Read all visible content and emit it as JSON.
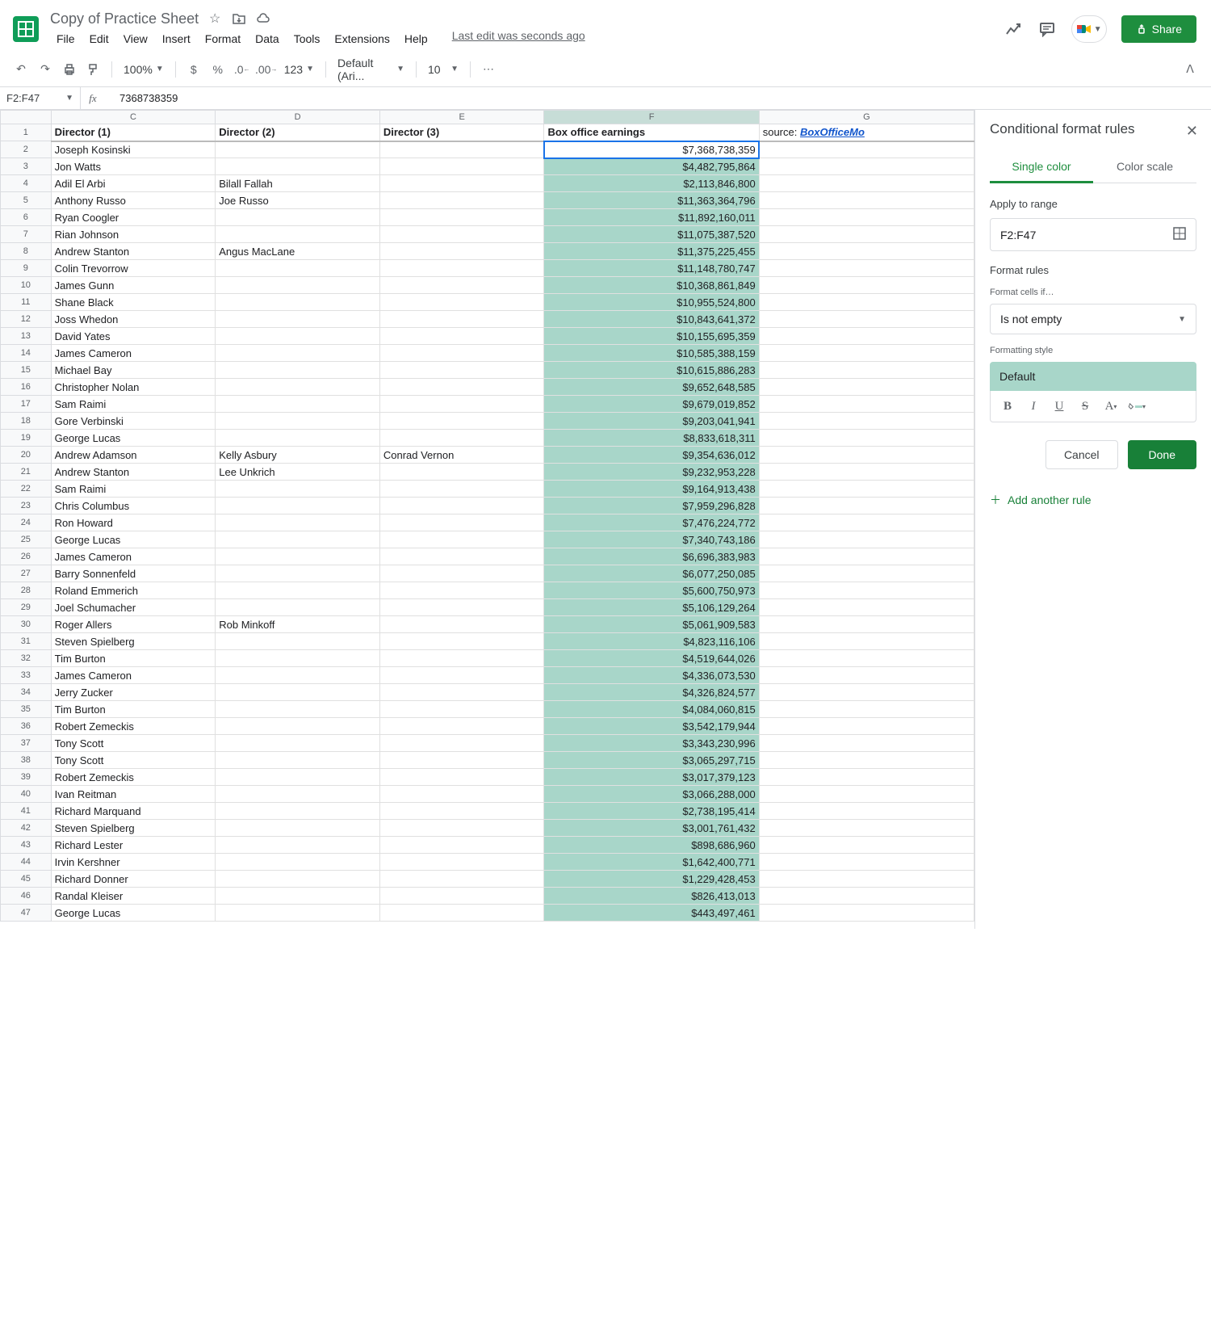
{
  "doc": {
    "title": "Copy of Practice Sheet"
  },
  "menubar": {
    "file": "File",
    "edit": "Edit",
    "view": "View",
    "insert": "Insert",
    "format": "Format",
    "data": "Data",
    "tools": "Tools",
    "extensions": "Extensions",
    "help": "Help",
    "edit_info": "Last edit was seconds ago"
  },
  "share": {
    "label": "Share"
  },
  "toolbar": {
    "zoom": "100%",
    "font": "Default (Ari...",
    "fontsize": "10"
  },
  "namebox": {
    "ref": "F2:F47",
    "fxval": "7368738359"
  },
  "sidepanel": {
    "title": "Conditional format rules",
    "tab_single": "Single color",
    "tab_scale": "Color scale",
    "apply_label": "Apply to range",
    "range_value": "F2:F47",
    "rules_label": "Format rules",
    "cells_if": "Format cells if…",
    "condition": "Is not empty",
    "style_label": "Formatting style",
    "style_name": "Default",
    "cancel": "Cancel",
    "done": "Done",
    "add_rule": "Add another rule"
  },
  "headers": {
    "C": "Director (1)",
    "D": "Director (2)",
    "E": "Director (3)",
    "F": "Box office earnings",
    "G_prefix": "source: ",
    "G_link": "BoxOfficeMo"
  },
  "cols": {
    "C": "C",
    "D": "D",
    "E": "E",
    "F": "F",
    "G": "G"
  },
  "rows": [
    {
      "n": 2,
      "c": "Joseph Kosinski",
      "d": "",
      "e": "",
      "f": "$7,368,738,359"
    },
    {
      "n": 3,
      "c": "Jon Watts",
      "d": "",
      "e": "",
      "f": "$4,482,795,864"
    },
    {
      "n": 4,
      "c": "Adil El Arbi",
      "d": "Bilall Fallah",
      "e": "",
      "f": "$2,113,846,800"
    },
    {
      "n": 5,
      "c": "Anthony Russo",
      "d": "Joe Russo",
      "e": "",
      "f": "$11,363,364,796"
    },
    {
      "n": 6,
      "c": "Ryan Coogler",
      "d": "",
      "e": "",
      "f": "$11,892,160,011"
    },
    {
      "n": 7,
      "c": "Rian Johnson",
      "d": "",
      "e": "",
      "f": "$11,075,387,520"
    },
    {
      "n": 8,
      "c": "Andrew Stanton",
      "d": "Angus MacLane",
      "e": "",
      "f": "$11,375,225,455"
    },
    {
      "n": 9,
      "c": "Colin Trevorrow",
      "d": "",
      "e": "",
      "f": "$11,148,780,747"
    },
    {
      "n": 10,
      "c": "James Gunn",
      "d": "",
      "e": "",
      "f": "$10,368,861,849"
    },
    {
      "n": 11,
      "c": "Shane Black",
      "d": "",
      "e": "",
      "f": "$10,955,524,800"
    },
    {
      "n": 12,
      "c": "Joss Whedon",
      "d": "",
      "e": "",
      "f": "$10,843,641,372"
    },
    {
      "n": 13,
      "c": "David Yates",
      "d": "",
      "e": "",
      "f": "$10,155,695,359"
    },
    {
      "n": 14,
      "c": "James Cameron",
      "d": "",
      "e": "",
      "f": "$10,585,388,159"
    },
    {
      "n": 15,
      "c": "Michael Bay",
      "d": "",
      "e": "",
      "f": "$10,615,886,283"
    },
    {
      "n": 16,
      "c": "Christopher Nolan",
      "d": "",
      "e": "",
      "f": "$9,652,648,585"
    },
    {
      "n": 17,
      "c": "Sam Raimi",
      "d": "",
      "e": "",
      "f": "$9,679,019,852"
    },
    {
      "n": 18,
      "c": "Gore Verbinski",
      "d": "",
      "e": "",
      "f": "$9,203,041,941"
    },
    {
      "n": 19,
      "c": "George Lucas",
      "d": "",
      "e": "",
      "f": "$8,833,618,311"
    },
    {
      "n": 20,
      "c": "Andrew Adamson",
      "d": "Kelly Asbury",
      "e": "Conrad Vernon",
      "f": "$9,354,636,012"
    },
    {
      "n": 21,
      "c": "Andrew Stanton",
      "d": "Lee Unkrich",
      "e": "",
      "f": "$9,232,953,228"
    },
    {
      "n": 22,
      "c": "Sam Raimi",
      "d": "",
      "e": "",
      "f": "$9,164,913,438"
    },
    {
      "n": 23,
      "c": "Chris Columbus",
      "d": "",
      "e": "",
      "f": "$7,959,296,828"
    },
    {
      "n": 24,
      "c": "Ron Howard",
      "d": "",
      "e": "",
      "f": "$7,476,224,772"
    },
    {
      "n": 25,
      "c": "George Lucas",
      "d": "",
      "e": "",
      "f": "$7,340,743,186"
    },
    {
      "n": 26,
      "c": "James Cameron",
      "d": "",
      "e": "",
      "f": "$6,696,383,983"
    },
    {
      "n": 27,
      "c": "Barry Sonnenfeld",
      "d": "",
      "e": "",
      "f": "$6,077,250,085"
    },
    {
      "n": 28,
      "c": "Roland Emmerich",
      "d": "",
      "e": "",
      "f": "$5,600,750,973"
    },
    {
      "n": 29,
      "c": "Joel Schumacher",
      "d": "",
      "e": "",
      "f": "$5,106,129,264"
    },
    {
      "n": 30,
      "c": "Roger Allers",
      "d": "Rob Minkoff",
      "e": "",
      "f": "$5,061,909,583"
    },
    {
      "n": 31,
      "c": "Steven Spielberg",
      "d": "",
      "e": "",
      "f": "$4,823,116,106"
    },
    {
      "n": 32,
      "c": "Tim Burton",
      "d": "",
      "e": "",
      "f": "$4,519,644,026"
    },
    {
      "n": 33,
      "c": "James Cameron",
      "d": "",
      "e": "",
      "f": "$4,336,073,530"
    },
    {
      "n": 34,
      "c": "Jerry Zucker",
      "d": "",
      "e": "",
      "f": "$4,326,824,577"
    },
    {
      "n": 35,
      "c": "Tim Burton",
      "d": "",
      "e": "",
      "f": "$4,084,060,815"
    },
    {
      "n": 36,
      "c": "Robert Zemeckis",
      "d": "",
      "e": "",
      "f": "$3,542,179,944"
    },
    {
      "n": 37,
      "c": "Tony Scott",
      "d": "",
      "e": "",
      "f": "$3,343,230,996"
    },
    {
      "n": 38,
      "c": "Tony Scott",
      "d": "",
      "e": "",
      "f": "$3,065,297,715"
    },
    {
      "n": 39,
      "c": "Robert Zemeckis",
      "d": "",
      "e": "",
      "f": "$3,017,379,123"
    },
    {
      "n": 40,
      "c": "Ivan Reitman",
      "d": "",
      "e": "",
      "f": "$3,066,288,000"
    },
    {
      "n": 41,
      "c": "Richard Marquand",
      "d": "",
      "e": "",
      "f": "$2,738,195,414"
    },
    {
      "n": 42,
      "c": "Steven Spielberg",
      "d": "",
      "e": "",
      "f": "$3,001,761,432"
    },
    {
      "n": 43,
      "c": "Richard Lester",
      "d": "",
      "e": "",
      "f": "$898,686,960"
    },
    {
      "n": 44,
      "c": "Irvin Kershner",
      "d": "",
      "e": "",
      "f": "$1,642,400,771"
    },
    {
      "n": 45,
      "c": "Richard Donner",
      "d": "",
      "e": "",
      "f": "$1,229,428,453"
    },
    {
      "n": 46,
      "c": "Randal Kleiser",
      "d": "",
      "e": "",
      "f": "$826,413,013"
    },
    {
      "n": 47,
      "c": "George Lucas",
      "d": "",
      "e": "",
      "f": "$443,497,461"
    }
  ]
}
